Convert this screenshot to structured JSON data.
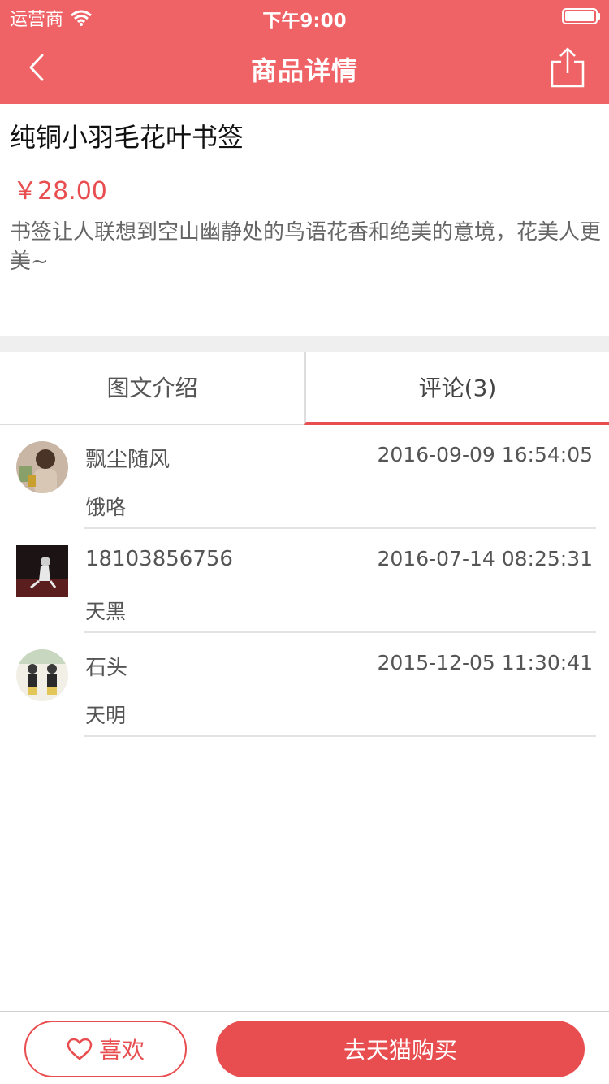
{
  "status_bar": {
    "carrier": "运营商",
    "time": "下午9:00"
  },
  "nav": {
    "title": "商品详情"
  },
  "product": {
    "title": "纯铜小羽毛花叶书签",
    "price": "￥28.00",
    "description": "书签让人联想到空山幽静处的鸟语花香和绝美的意境，花美人更美~"
  },
  "tabs": [
    {
      "label": "图文介绍",
      "active": false
    },
    {
      "label": "评论(3)",
      "active": true
    }
  ],
  "comments": [
    {
      "user": "飘尘随风",
      "time": "2016-09-09 16:54:05",
      "text": "饿咯"
    },
    {
      "user": "18103856756",
      "time": "2016-07-14 08:25:31",
      "text": "天黑"
    },
    {
      "user": "石头",
      "time": "2015-12-05 11:30:41",
      "text": "天明"
    }
  ],
  "bottom": {
    "like_label": "喜欢",
    "buy_label": "去天猫购买"
  },
  "colors": {
    "accent": "#ef6366",
    "button": "#e84d4f",
    "divider": "#e3e3e3"
  }
}
